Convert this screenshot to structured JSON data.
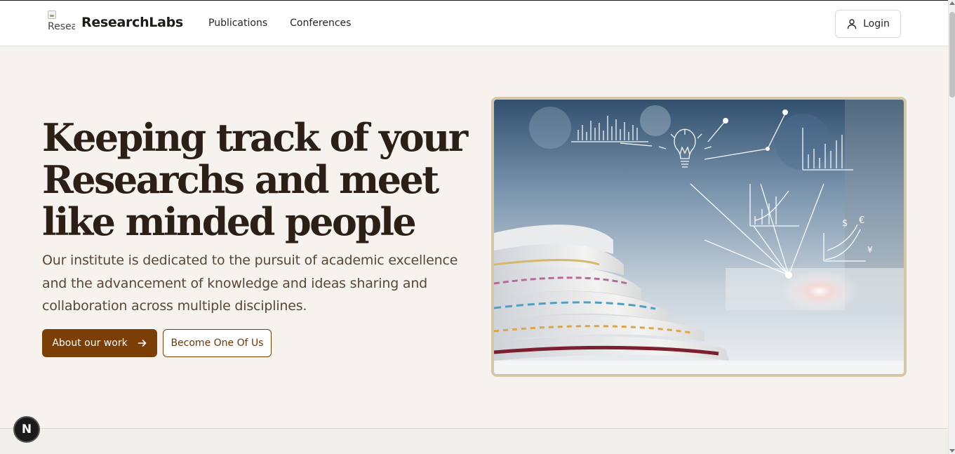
{
  "header": {
    "logo_alt": "Research",
    "brand": "ResearchLabs",
    "nav": [
      "Publications",
      "Conferences"
    ],
    "login_label": "Login"
  },
  "hero": {
    "title": "Keeping track of your Researchs and meet like minded people",
    "description": "Our institute is dedicated to the pursuit of academic excellence and the advancement of knowledge and ideas sharing and collaboration across multiple disciplines.",
    "primary_cta": "About our work",
    "secondary_cta": "Become One Of Us"
  },
  "dev_badge": "N",
  "colors": {
    "primary": "#7a3e06",
    "background": "#f6f3ee",
    "frame": "#d6c6a8",
    "heading": "#2c1f15"
  }
}
